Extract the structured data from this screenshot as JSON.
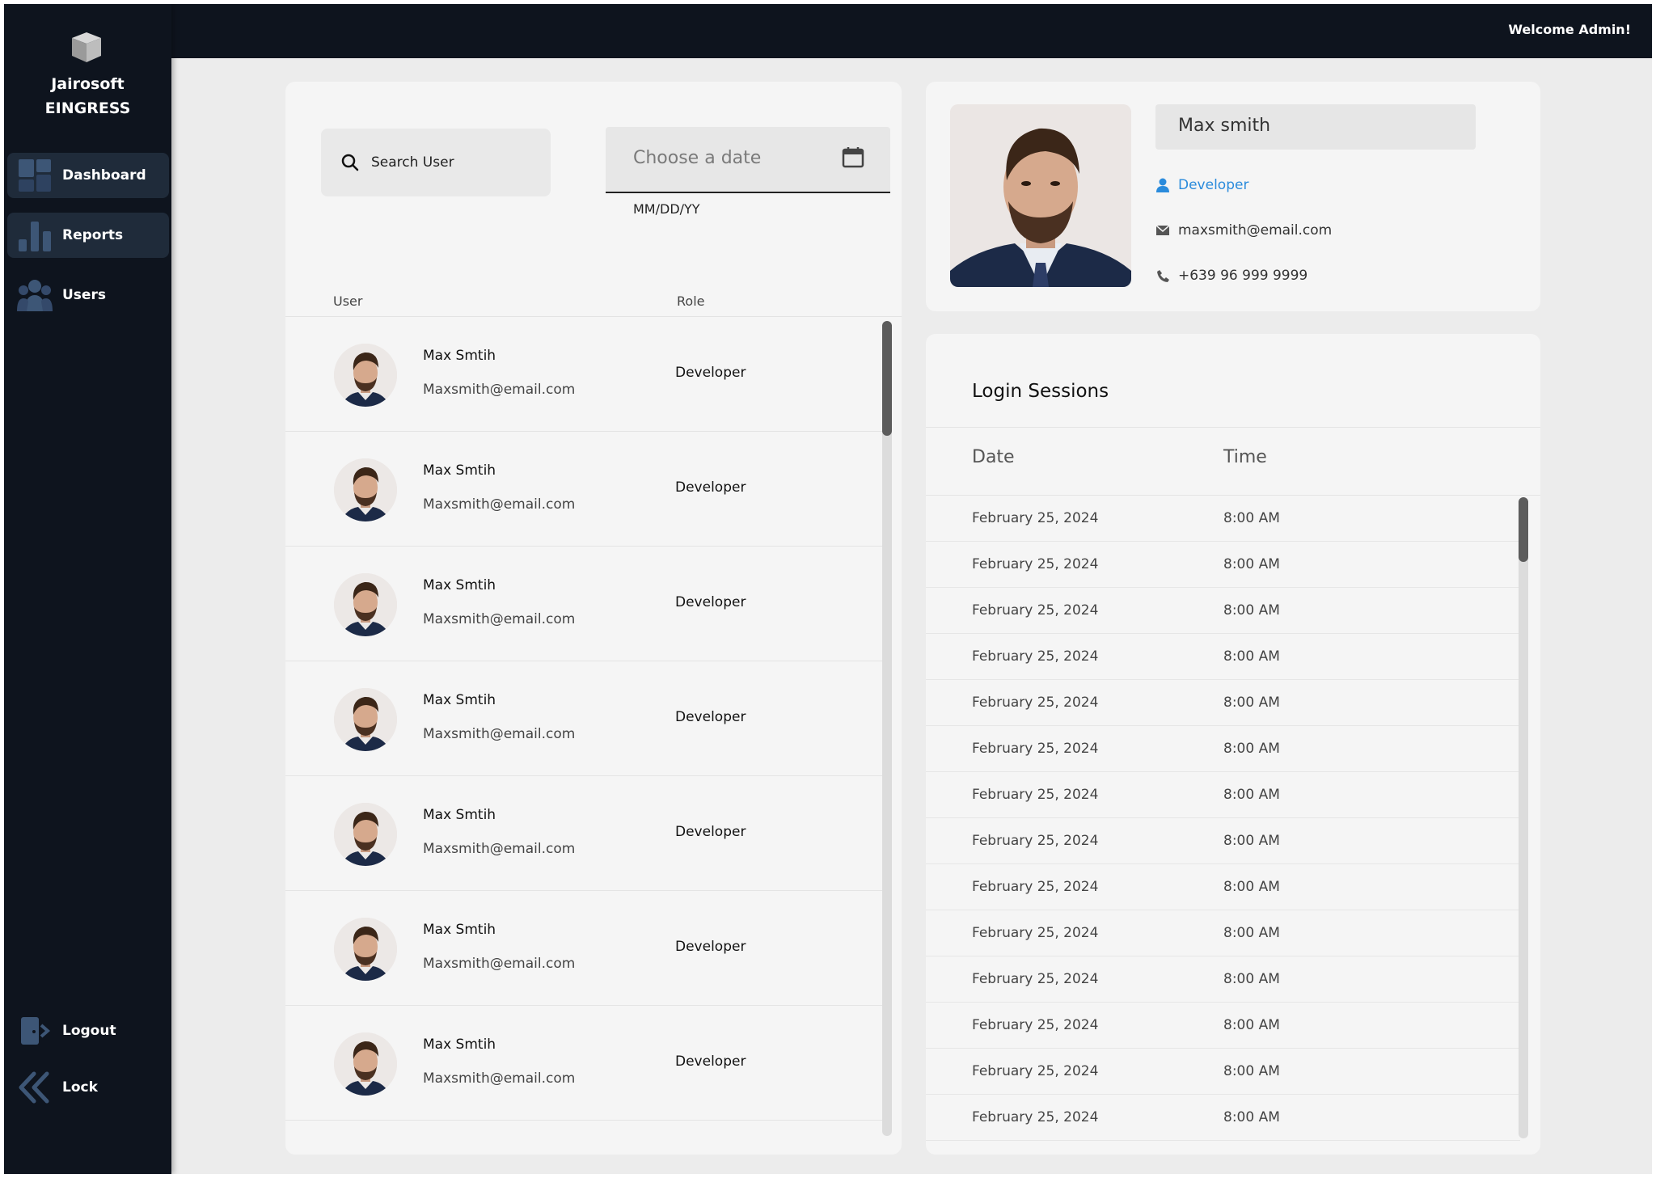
{
  "header": {
    "welcome": "Welcome Admin!"
  },
  "brand": {
    "line1": "Jairosoft",
    "line2": "EINGRESS"
  },
  "sidebar": {
    "items": [
      {
        "label": "Dashboard",
        "icon": "dashboard-icon",
        "active": true
      },
      {
        "label": "Reports",
        "icon": "reports-icon",
        "active": true
      },
      {
        "label": "Users",
        "icon": "users-icon",
        "active": false
      }
    ],
    "logout": {
      "label": "Logout",
      "icon": "logout-icon"
    },
    "lock": {
      "label": "Lock",
      "icon": "lock-icon"
    }
  },
  "search": {
    "label": "Search User"
  },
  "date_picker": {
    "placeholder": "Choose a date",
    "format_hint": "MM/DD/YY"
  },
  "user_table": {
    "columns": [
      "User",
      "Role"
    ],
    "rows": [
      {
        "name": "Max Smtih",
        "email": "Maxsmith@email.com",
        "role": "Developer"
      },
      {
        "name": "Max Smtih",
        "email": "Maxsmith@email.com",
        "role": "Developer"
      },
      {
        "name": "Max Smtih",
        "email": "Maxsmith@email.com",
        "role": "Developer"
      },
      {
        "name": "Max Smtih",
        "email": "Maxsmith@email.com",
        "role": "Developer"
      },
      {
        "name": "Max Smtih",
        "email": "Maxsmith@email.com",
        "role": "Developer"
      },
      {
        "name": "Max Smtih",
        "email": "Maxsmith@email.com",
        "role": "Developer"
      },
      {
        "name": "Max Smtih",
        "email": "Maxsmith@email.com",
        "role": "Developer"
      }
    ]
  },
  "profile": {
    "name": "Max smith",
    "role": "Developer",
    "email": "maxsmith@email.com",
    "phone": "+639 96 999 9999"
  },
  "sessions": {
    "title": "Login Sessions",
    "columns": [
      "Date",
      "Time"
    ],
    "rows": [
      {
        "date": "February 25, 2024",
        "time": "8:00 AM"
      },
      {
        "date": "February 25, 2024",
        "time": "8:00 AM"
      },
      {
        "date": "February 25, 2024",
        "time": "8:00 AM"
      },
      {
        "date": "February 25, 2024",
        "time": "8:00 AM"
      },
      {
        "date": "February 25, 2024",
        "time": "8:00 AM"
      },
      {
        "date": "February 25, 2024",
        "time": "8:00 AM"
      },
      {
        "date": "February 25, 2024",
        "time": "8:00 AM"
      },
      {
        "date": "February 25, 2024",
        "time": "8:00 AM"
      },
      {
        "date": "February 25, 2024",
        "time": "8:00 AM"
      },
      {
        "date": "February 25, 2024",
        "time": "8:00 AM"
      },
      {
        "date": "February 25, 2024",
        "time": "8:00 AM"
      },
      {
        "date": "February 25, 2024",
        "time": "8:00 AM"
      },
      {
        "date": "February 25, 2024",
        "time": "8:00 AM"
      },
      {
        "date": "February 25, 2024",
        "time": "8:00 AM"
      }
    ]
  },
  "colors": {
    "sidebar_bg": "#0e141e",
    "active_nav": "#1f2b3a",
    "accent_blue": "#2a8bdc",
    "page_bg": "#ececec",
    "card_bg": "#f5f5f5"
  }
}
